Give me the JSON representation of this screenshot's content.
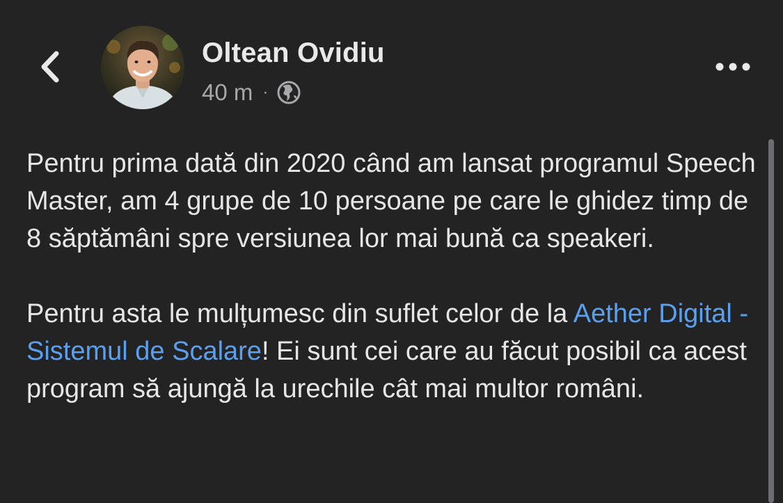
{
  "header": {
    "back_icon": "chevron-left-icon",
    "author_name": "Oltean Ovidiu",
    "timestamp": "40 m",
    "separator": "·",
    "privacy_icon": "globe-icon",
    "more_icon": "more-horizontal-icon"
  },
  "post": {
    "paragraph1": "Pentru prima dată din 2020 când am lansat programul Speech Master, am 4 grupe de 10 persoane pe care le ghidez timp de 8 săptămâni spre versiunea lor mai bună ca speakeri.",
    "paragraph2_start": "Pentru asta le mulțumesc din suflet celor de la ",
    "paragraph2_link": "Aether Digital - Sistemul de Scalare",
    "paragraph2_end": "! Ei sunt cei care au făcut posibil ca acest program să ajungă la urechile cât mai multor români."
  },
  "colors": {
    "background": "#232324",
    "text": "#e6e6e7",
    "secondary_text": "#a8a8aa",
    "link": "#5aa0ee"
  }
}
